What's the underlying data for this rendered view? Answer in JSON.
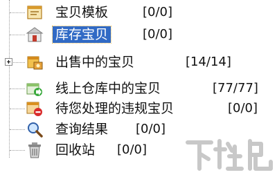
{
  "tree": {
    "items": [
      {
        "label": "宝贝模板",
        "count": "[0/0]",
        "icon": "template-icon",
        "selected": false,
        "expandable": false
      },
      {
        "label": "库存宝贝",
        "count": "[0/0]",
        "icon": "warehouse-icon",
        "selected": true,
        "expandable": false
      },
      {
        "label": "出售中的宝贝",
        "count": "[14/14]",
        "icon": "on-sale-icon",
        "selected": false,
        "expandable": true
      },
      {
        "label": "线上仓库中的宝贝",
        "count": "[77/77]",
        "icon": "online-warehouse-icon",
        "selected": false,
        "expandable": false
      },
      {
        "label": "待您处理的违规宝贝",
        "count": "[0/0]",
        "icon": "violation-icon",
        "selected": false,
        "expandable": false
      },
      {
        "label": "查询结果",
        "count": "[0/0]",
        "icon": "search-icon",
        "selected": false,
        "expandable": false
      },
      {
        "label": "回收站",
        "count": "[0/0]",
        "icon": "recycle-bin-icon",
        "selected": false,
        "expandable": false
      }
    ]
  },
  "watermark": {
    "text": "下载吧"
  },
  "colors": {
    "selection": "#316ac5",
    "selection_text": "#ffffff"
  }
}
